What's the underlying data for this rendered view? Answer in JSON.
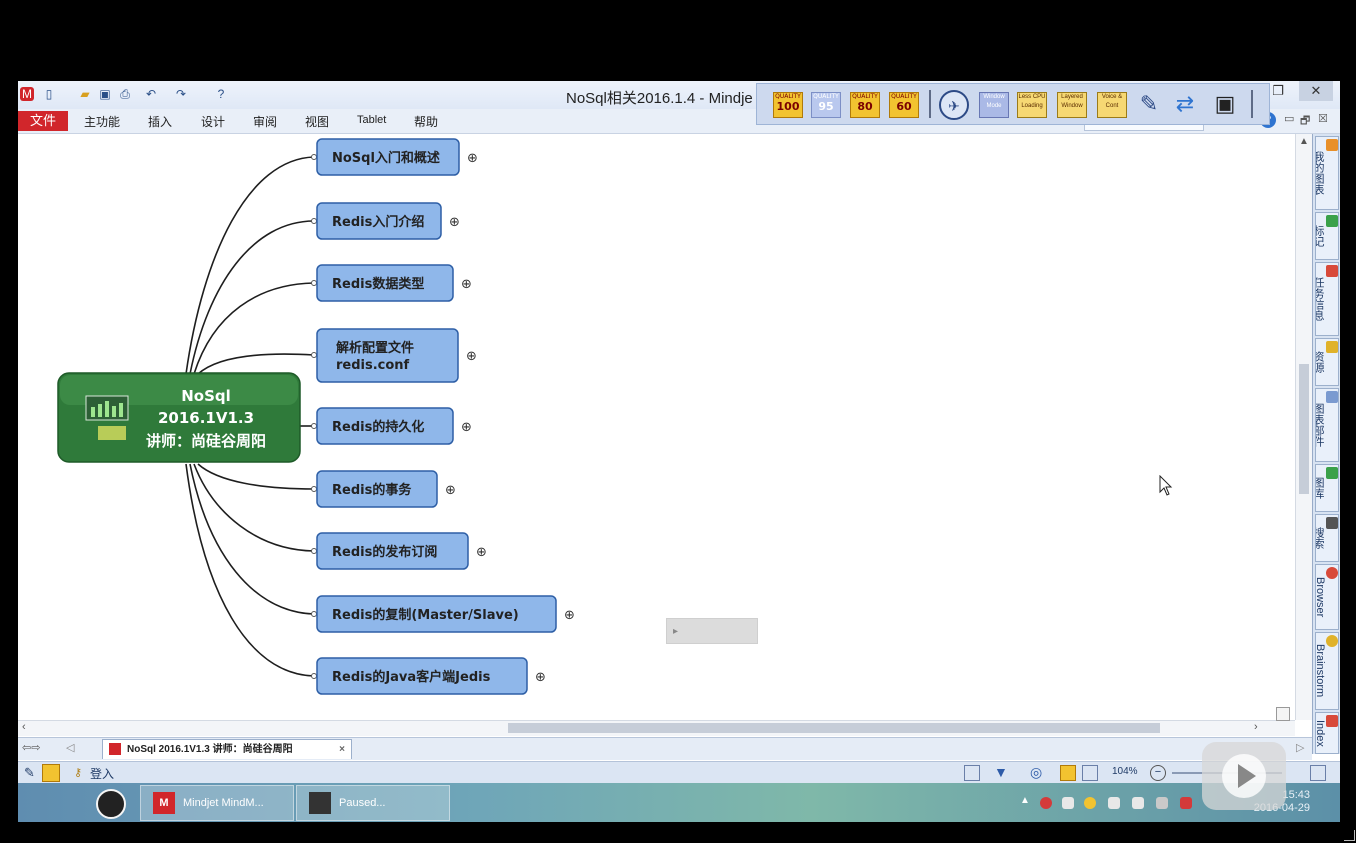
{
  "window": {
    "title": "NoSql相关2016.1.4 - Mindje",
    "controls": {
      "restore": "❐",
      "close": "✕"
    }
  },
  "quality_toolbar": {
    "quality_label": "QUALITY",
    "buttons": [
      "100",
      "95",
      "80",
      "60"
    ],
    "extra_buttons": [
      "Window Mode",
      "Less CPU Loading",
      "Layered Window",
      "Voice & Cont"
    ]
  },
  "menu": {
    "items": [
      "文件",
      "主功能",
      "插入",
      "设计",
      "审阅",
      "视图",
      "Tablet",
      "帮助"
    ],
    "zoom_label": "104%",
    "inner_controls": [
      "▭",
      "🗗",
      "☒"
    ]
  },
  "mindmap": {
    "central": {
      "line1": "NoSql",
      "line2": "2016.1V1.3",
      "line3": "讲师：尚硅谷周阳"
    },
    "topics": [
      {
        "label": "NoSql入门和概述"
      },
      {
        "label": "Redis入门介绍"
      },
      {
        "label": "Redis数据类型"
      },
      {
        "label_line1": "解析配置文件",
        "label_line2": "redis.conf"
      },
      {
        "label": "Redis的持久化"
      },
      {
        "label": "Redis的事务"
      },
      {
        "label": "Redis的发布订阅"
      },
      {
        "label": "Redis的复制(Master/Slave)"
      },
      {
        "label": "Redis的Java客户端Jedis"
      }
    ],
    "expand_symbol": "⊕"
  },
  "side_panel": {
    "tabs": [
      "我的图表",
      "标记",
      "任务信息",
      "资源",
      "图表部件",
      "图库",
      "搜索",
      "Browser",
      "Brainstorm",
      "Index"
    ]
  },
  "doc_tab": {
    "label": "NoSql 2016.1V1.3 讲师：尚硅谷周阳",
    "close": "×"
  },
  "status": {
    "login": "登入",
    "zoom": "104%"
  },
  "taskbar": {
    "items": [
      "Mindjet MindM...",
      "Paused..."
    ],
    "clock": {
      "time": "15:43",
      "date": "2016-04-29"
    }
  },
  "colors": {
    "topic_fill": "#8fb7ea",
    "topic_border": "#2e5fa6",
    "central_fill": "#2f7a3a",
    "file_menu": "#d1262b"
  },
  "icons": [
    "app-icon",
    "new-doc-icon",
    "open-folder-icon",
    "save-icon",
    "print-icon",
    "undo-icon",
    "redo-icon",
    "help-icon",
    "help-circle-icon",
    "qq-penguin-icon",
    "mindjet-icon",
    "video-icon",
    "play-icon",
    "mouse-cursor-icon"
  ]
}
